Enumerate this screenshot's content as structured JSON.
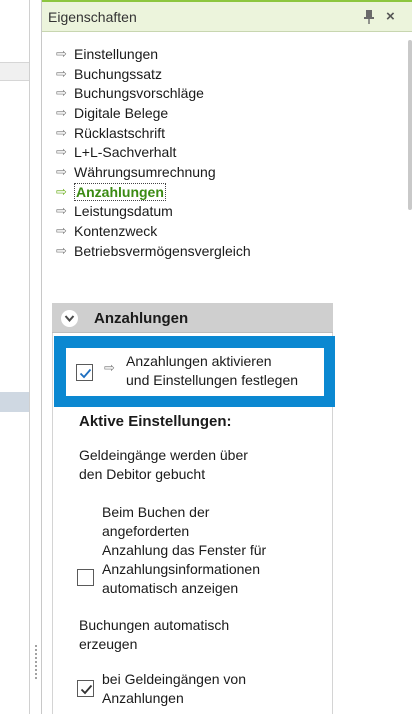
{
  "panel": {
    "title": "Eigenschaften",
    "pin_icon": "pin-icon",
    "close_label": "×"
  },
  "nav": {
    "arrow_glyph": "⇨",
    "items": [
      {
        "label": "Einstellungen"
      },
      {
        "label": "Buchungssatz"
      },
      {
        "label": "Buchungsvorschläge"
      },
      {
        "label": "Digitale Belege"
      },
      {
        "label": "Rücklastschrift"
      },
      {
        "label": "L+L-Sachverhalt"
      },
      {
        "label": "Währungsumrechnung"
      },
      {
        "label": "Anzahlungen",
        "active": true
      },
      {
        "label": "Leistungsdatum"
      },
      {
        "label": "Kontenzweck"
      },
      {
        "label": "Betriebsvermögensvergleich"
      }
    ]
  },
  "section": {
    "title": "Anzahlungen",
    "activate": {
      "line1": "Anzahlungen aktivieren",
      "line2": "und Einstellungen festlegen",
      "checked": true
    },
    "active_heading": "Aktive Einstellungen:",
    "debitor_line1": "Geldeingänge werden über",
    "debitor_line2": "den Debitor gebucht",
    "option1": {
      "lines": [
        "Beim Buchen der",
        "angeforderten",
        "Anzahlung das Fenster für",
        "Anzahlungsinformationen",
        "automatisch anzeigen"
      ],
      "checked": false
    },
    "auto_line1": "Buchungen automatisch",
    "auto_line2": "erzeugen",
    "option2": {
      "lines": [
        "bei Geldeingängen von",
        "Anzahlungen"
      ],
      "checked": true
    }
  },
  "colors": {
    "accent_green": "#8dc63f",
    "active_green": "#3a8a12",
    "highlight_blue": "#0b88d1",
    "section_header": "#cfcfcf"
  }
}
